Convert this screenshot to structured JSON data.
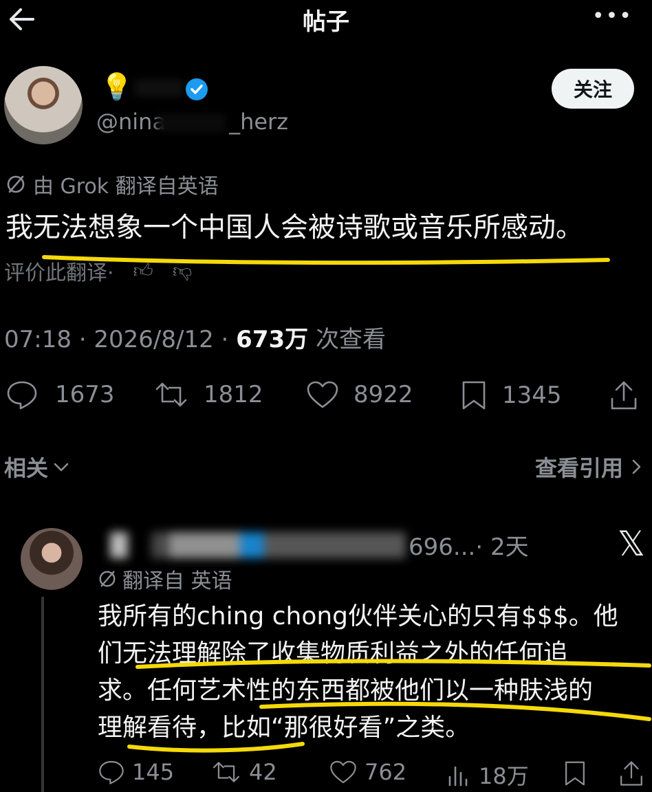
{
  "header": {
    "title": "帖子"
  },
  "post": {
    "handle": "@nina",
    "handle_tail": "_herz",
    "follow_label": "关注",
    "translated_by": "由 Grok 翻译自英语",
    "text": "我无法想象一个中国人会被诗歌或音乐所感动。",
    "rate_translation": "评价此翻译·",
    "time": "07:18 · 2026/8/12 · ",
    "views_count": "673万",
    "views_label": " 次查看",
    "stats": {
      "replies": "1673",
      "reposts": "1812",
      "likes": "8922",
      "bookmarks": "1345"
    }
  },
  "related": {
    "label": "相关",
    "view_quotes": "查看引用"
  },
  "reply": {
    "handle_partial": "696...",
    "time": "· 2天",
    "translated": "翻译自 英语",
    "text_lines": [
      "我所有的ching chong伙伴关心的只有$$$。他",
      "们无法理解除了收集物质利益之外的任何追",
      "求。任何艺术性的东西都被他们以一种肤浅的",
      "理解看待，比如“那很好看”之类。"
    ],
    "stats": {
      "replies": "145",
      "reposts": "42",
      "likes": "762",
      "views": "18万"
    }
  },
  "colors": {
    "highlight": "#f5d90a",
    "verified": "#1d9bf0"
  },
  "icons": [
    "back-arrow-icon",
    "more-icon",
    "verified-icon",
    "translate-icon",
    "reply-icon",
    "repost-icon",
    "like-icon",
    "bookmark-icon",
    "share-icon",
    "chevron-down-icon",
    "chevron-right-icon",
    "x-logo-icon",
    "views-icon"
  ]
}
